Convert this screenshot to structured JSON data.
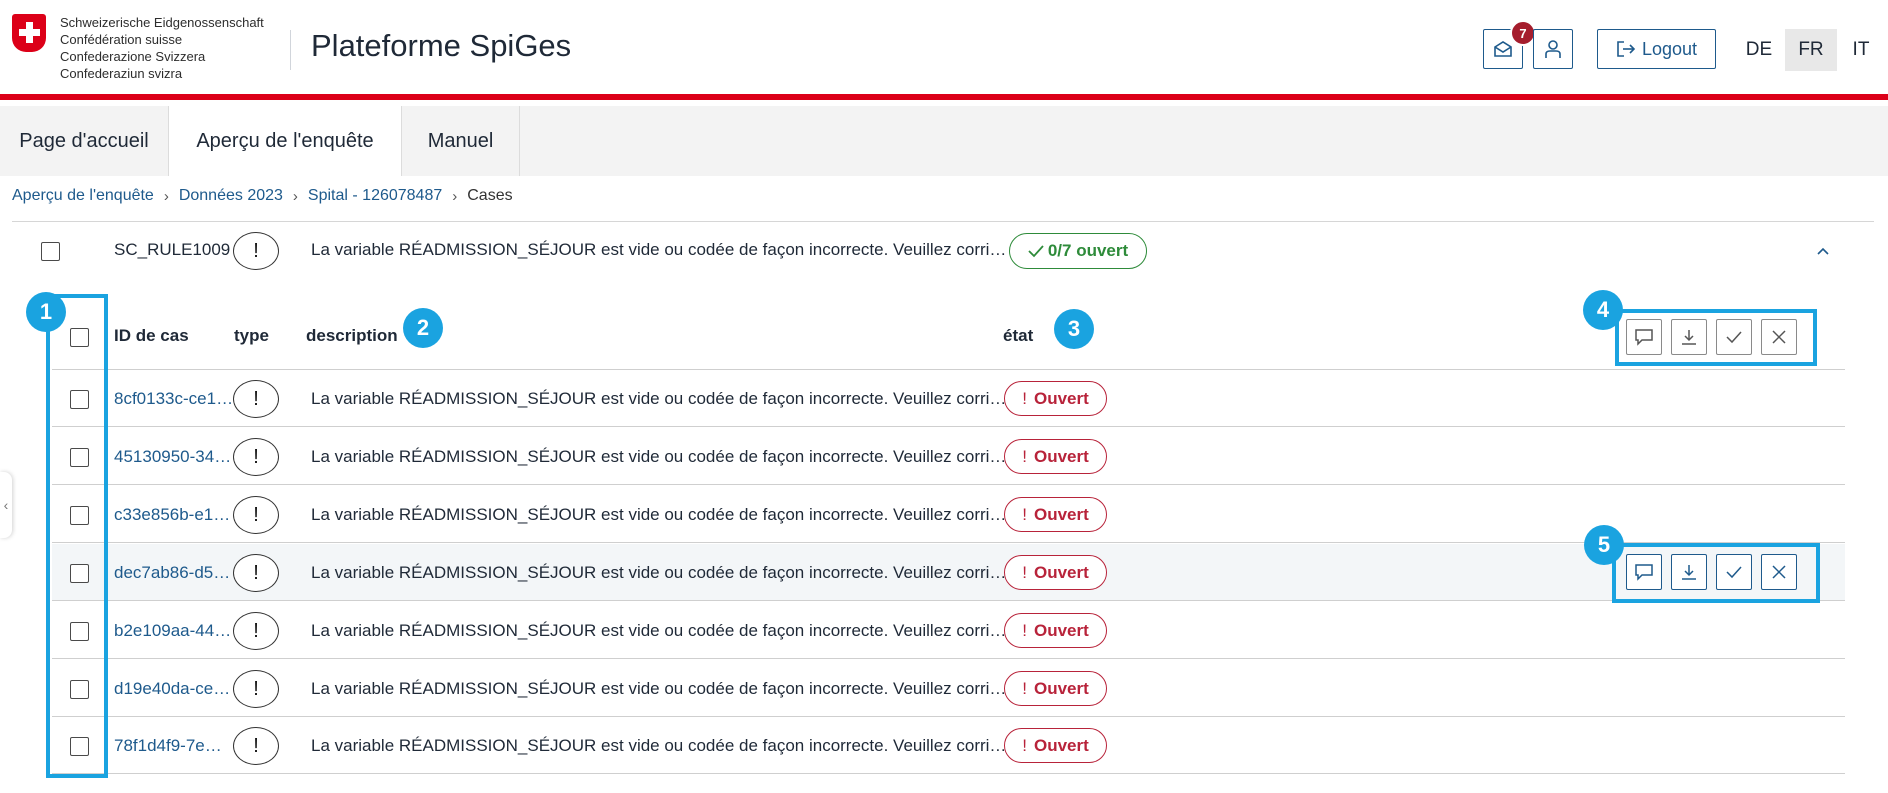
{
  "header": {
    "confederation": [
      "Schweizerische Eidgenossenschaft",
      "Confédération suisse",
      "Confederazione Svizzera",
      "Confederaziun svizra"
    ],
    "app_title": "Plateforme SpiGes",
    "notifications_count": "7",
    "logout_label": "Logout",
    "languages": [
      "DE",
      "FR",
      "IT"
    ],
    "active_language": "FR",
    "brand_color": "#dc0018"
  },
  "nav": {
    "tabs": [
      {
        "label": "Page d'accueil",
        "active": false
      },
      {
        "label": "Aperçu de l'enquête",
        "active": true
      },
      {
        "label": "Manuel",
        "active": false
      }
    ]
  },
  "breadcrumb": {
    "items": [
      "Aperçu de l'enquête",
      "Données 2023",
      "Spital - 126078487"
    ],
    "current": "Cases"
  },
  "group": {
    "rule_id": "SC_RULE1009",
    "type_symbol": "!",
    "description": "La variable RÉADMISSION_SÉJOUR est vide ou codée de façon incorrecte. Veuillez corri…",
    "open_count": "0/7 ouvert",
    "open_color": "#2e8b3a"
  },
  "table": {
    "headers": {
      "case_id": "ID de cas",
      "type": "type",
      "description": "description",
      "state": "état"
    },
    "rows": [
      {
        "case_id": "8cf0133c-ce1…",
        "type_symbol": "!",
        "description": "La variable RÉADMISSION_SÉJOUR est vide ou codée de façon incorrecte. Veuillez corri…",
        "state": "Ouvert"
      },
      {
        "case_id": "45130950-34…",
        "type_symbol": "!",
        "description": "La variable RÉADMISSION_SÉJOUR est vide ou codée de façon incorrecte. Veuillez corri…",
        "state": "Ouvert"
      },
      {
        "case_id": "c33e856b-e1…",
        "type_symbol": "!",
        "description": "La variable RÉADMISSION_SÉJOUR est vide ou codée de façon incorrecte. Veuillez corri…",
        "state": "Ouvert"
      },
      {
        "case_id": "dec7ab86-d5…",
        "type_symbol": "!",
        "description": "La variable RÉADMISSION_SÉJOUR est vide ou codée de façon incorrecte. Veuillez corri…",
        "state": "Ouvert"
      },
      {
        "case_id": "b2e109aa-44…",
        "type_symbol": "!",
        "description": "La variable RÉADMISSION_SÉJOUR est vide ou codée de façon incorrecte. Veuillez corri…",
        "state": "Ouvert"
      },
      {
        "case_id": "d19e40da-ce…",
        "type_symbol": "!",
        "description": "La variable RÉADMISSION_SÉJOUR est vide ou codée de façon incorrecte. Veuillez corri…",
        "state": "Ouvert"
      },
      {
        "case_id": "78f1d4f9-7e…",
        "type_symbol": "!",
        "description": "La variable RÉADMISSION_SÉJOUR est vide ou codée de façon incorrecte. Veuillez corri…",
        "state": "Ouvert"
      }
    ],
    "state_color": "#b8233a"
  },
  "bulk_actions": [
    "comment-icon",
    "download-icon",
    "check-icon",
    "close-icon"
  ],
  "annotations": {
    "markers": [
      "1",
      "2",
      "3",
      "4",
      "5"
    ],
    "color": "#1aa3e0"
  }
}
